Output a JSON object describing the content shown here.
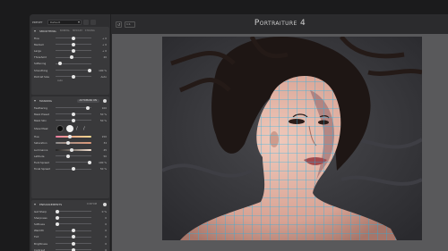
{
  "app": {
    "title": "Portraiture 4"
  },
  "preset": {
    "label": "PRESET",
    "value": "Default"
  },
  "toolbar": {
    "undo_icon": "undo-icon",
    "zoom": "1:1"
  },
  "smoothing": {
    "header": "SMOOTHING",
    "tabs": [
      "NORMAL",
      "MEDIUM",
      "STRONG"
    ],
    "sliders": [
      {
        "label": "Fine",
        "value": "+ 0",
        "pos": 0.5
      },
      {
        "label": "Medium",
        "value": "+ 0",
        "pos": 0.5
      },
      {
        "label": "Large",
        "value": "+ 0",
        "pos": 0.5
      },
      {
        "label": "Threshold",
        "value": "20",
        "pos": 0.45
      },
      {
        "label": "Softening",
        "value": "",
        "pos": 0.12
      },
      {
        "label": "Smoothing",
        "value": "100 %",
        "pos": 0.95
      },
      {
        "label": "Portrait Size",
        "value": "Auto",
        "pos": 0.5
      }
    ],
    "sub_label": "Auto"
  },
  "masking": {
    "header": "MASKING",
    "pill": "AUTOMASK ON",
    "sliders_top": [
      {
        "label": "Feathering",
        "value": "100",
        "pos": 0.9
      },
      {
        "label": "Mask Preset",
        "value": "50 %",
        "pos": 0.5
      },
      {
        "label": "Mask Skin",
        "value": "50 %",
        "pos": 0.5
      }
    ],
    "show_mask_label": "Show Mask",
    "color_sliders": [
      {
        "label": "Hue",
        "value": "150",
        "pos": 0.4,
        "grad": "linear-gradient(90deg,#f07ca2,#f2b08a,#f0d890)"
      },
      {
        "label": "Saturation",
        "value": "34",
        "pos": 0.35,
        "grad": "linear-gradient(90deg,#8a8a8a,#e09a7a)"
      },
      {
        "label": "Luminance",
        "value": "45",
        "pos": 0.45,
        "grad": "linear-gradient(90deg,#222,#f6e2d2)"
      },
      {
        "label": "Latitude",
        "value": "50",
        "pos": 0.35,
        "grad": ""
      },
      {
        "label": "Fuzz Spread",
        "value": "100 %",
        "pos": 0.95,
        "grad": ""
      },
      {
        "label": "Tonal Spread",
        "value": "50 %",
        "pos": 0.5,
        "grad": ""
      }
    ]
  },
  "enhancements": {
    "header": "ENHANCEMENTS",
    "pill": "CUSTOM",
    "sliders": [
      {
        "label": "Get Sharp",
        "value": "0 %",
        "pos": 0.05
      },
      {
        "label": "Sharpness",
        "value": "0",
        "pos": 0.05
      },
      {
        "label": "Softness",
        "value": "0",
        "pos": 0.05
      },
      {
        "label": "Warmth",
        "value": "0",
        "pos": 0.5
      },
      {
        "label": "Tint",
        "value": "0",
        "pos": 0.5
      },
      {
        "label": "Brightness",
        "value": "0",
        "pos": 0.5
      },
      {
        "label": "Contrast",
        "value": "0",
        "pos": 0.5
      }
    ]
  },
  "colors": {
    "grid": "#1ab6e8",
    "panel": "#39393b"
  }
}
